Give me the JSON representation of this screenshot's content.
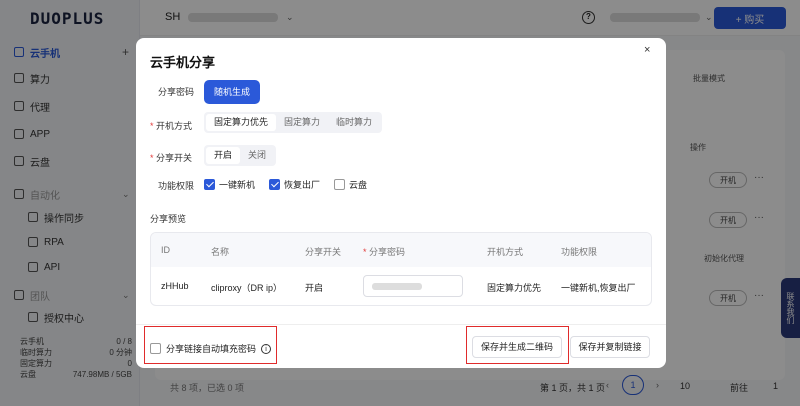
{
  "app": {
    "logo": "DUOPLUS",
    "sidebar": {
      "items": [
        {
          "label": "云手机",
          "icon": "phone-icon"
        },
        {
          "label": "算力",
          "icon": "monitor-icon"
        },
        {
          "label": "代理",
          "icon": "proxy-icon"
        },
        {
          "label": "APP",
          "icon": "grid-icon"
        },
        {
          "label": "云盘",
          "icon": "cloud-icon"
        }
      ],
      "group_automation": "自动化",
      "automation_items": [
        "操作同步",
        "RPA",
        "API"
      ],
      "group_team": "团队",
      "team_items": [
        "授权中心"
      ],
      "stats": [
        {
          "label": "云手机",
          "value": "0 / 8"
        },
        {
          "label": "临时算力",
          "value": "0 分钟"
        },
        {
          "label": "固定算力",
          "value": "0"
        },
        {
          "label": "云盘",
          "value": "747.98MB / 5GB"
        }
      ]
    },
    "topbar": {
      "region": "SH",
      "help": "?",
      "buy_label": "+ 购买"
    },
    "table_bg": {
      "batch_mode": "批量模式",
      "ops_header": "操作",
      "op_btn": "开机",
      "init_proxy": "初始化代理",
      "float_tab": "联系我们"
    },
    "pagination": {
      "total": "共 8 项，已选 0 项",
      "page_info": "第 1 页，共 1 页",
      "current": "1",
      "size": "10",
      "goto": "前往",
      "goto_num": "1",
      "page_unit": "页"
    }
  },
  "modal": {
    "title": "云手机分享",
    "close": "×",
    "password_label": "分享密码",
    "random_btn": "随机生成",
    "boot_label": "开机方式",
    "boot_options": [
      "固定算力优先",
      "固定算力",
      "临时算力"
    ],
    "share_label": "分享开关",
    "share_options": [
      "开启",
      "关闭"
    ],
    "perm_label": "功能权限",
    "perms": [
      {
        "label": "一键新机",
        "checked": true
      },
      {
        "label": "恢复出厂",
        "checked": true
      },
      {
        "label": "云盘",
        "checked": false
      }
    ],
    "preview_label": "分享预览",
    "preview_headers": [
      "ID",
      "名称",
      "分享开关",
      "分享密码",
      "开机方式",
      "功能权限"
    ],
    "preview_row": {
      "id": "zHHub",
      "name": "cliproxy（DR ip）",
      "share": "开启",
      "boot": "固定算力优先",
      "perms": "一键新机,恢复出厂"
    },
    "autofill_label": "分享链接自动填充密码",
    "btn_qr": "保存并生成二维码",
    "btn_copy": "保存并复制链接",
    "accent": "#2b59d9",
    "highlight": "#e02b2b"
  }
}
